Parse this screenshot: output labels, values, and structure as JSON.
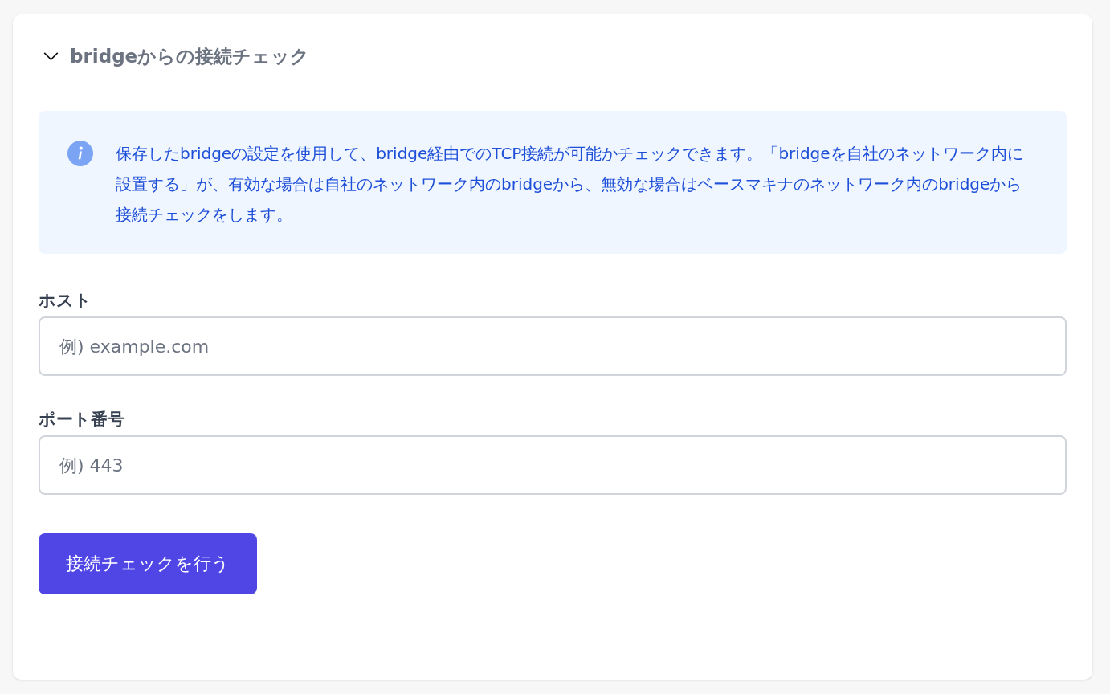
{
  "section": {
    "title": "bridgeからの接続チェック",
    "expanded": true
  },
  "info": {
    "text": "保存したbridgeの設定を使用して、bridge経由でのTCP接続が可能かチェックできます。「bridgeを自社のネットワーク内に設置する」が、有効な場合は自社のネットワーク内のbridgeから、無効な場合はベースマキナのネットワーク内のbridgeから接続チェックをします。"
  },
  "fields": [
    {
      "label": "ホスト",
      "placeholder": "例) example.com"
    },
    {
      "label": "ポート番号",
      "placeholder": "例) 443"
    }
  ],
  "button": {
    "label": "接続チェックを行う"
  }
}
